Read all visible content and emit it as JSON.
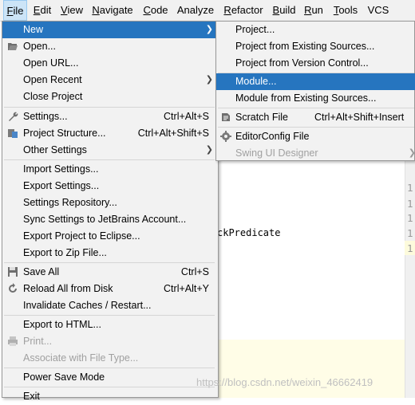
{
  "menubar": {
    "items": [
      {
        "label": "File",
        "mnemonic": "F",
        "rest": "ile"
      },
      {
        "label": "Edit",
        "mnemonic": "E",
        "rest": "dit"
      },
      {
        "label": "View",
        "mnemonic": "V",
        "rest": "iew"
      },
      {
        "label": "Navigate",
        "mnemonic": "N",
        "rest": "avigate"
      },
      {
        "label": "Code",
        "mnemonic": "C",
        "rest": "ode"
      },
      {
        "label": "Analyze",
        "mnemonic": "",
        "rest": "Analyze"
      },
      {
        "label": "Refactor",
        "mnemonic": "R",
        "rest": "efactor"
      },
      {
        "label": "Build",
        "mnemonic": "B",
        "rest": "uild"
      },
      {
        "label": "Run",
        "mnemonic": "R",
        "rest": "un"
      },
      {
        "label": "Tools",
        "mnemonic": "T",
        "rest": "ools"
      },
      {
        "label": "VCS",
        "mnemonic": "",
        "rest": "VCS"
      }
    ]
  },
  "file_menu": {
    "items": [
      {
        "label": "New"
      },
      {
        "label": "Open..."
      },
      {
        "label": "Open URL..."
      },
      {
        "label": "Open Recent"
      },
      {
        "label": "Close Project"
      },
      {
        "label": "Settings...",
        "shortcut": "Ctrl+Alt+S"
      },
      {
        "label": "Project Structure...",
        "shortcut": "Ctrl+Alt+Shift+S"
      },
      {
        "label": "Other Settings"
      },
      {
        "label": "Import Settings..."
      },
      {
        "label": "Export Settings..."
      },
      {
        "label": "Settings Repository..."
      },
      {
        "label": "Sync Settings to JetBrains Account..."
      },
      {
        "label": "Export Project to Eclipse..."
      },
      {
        "label": "Export to Zip File..."
      },
      {
        "label": "Save All",
        "shortcut": "Ctrl+S"
      },
      {
        "label": "Reload All from Disk",
        "shortcut": "Ctrl+Alt+Y"
      },
      {
        "label": "Invalidate Caches / Restart..."
      },
      {
        "label": "Export to HTML..."
      },
      {
        "label": "Print..."
      },
      {
        "label": "Associate with File Type..."
      },
      {
        "label": "Power Save Mode"
      },
      {
        "label": "Exit"
      }
    ]
  },
  "new_submenu": {
    "items": [
      {
        "label": "Project..."
      },
      {
        "label": "Project from Existing Sources..."
      },
      {
        "label": "Project from Version Control..."
      },
      {
        "label": "Module..."
      },
      {
        "label": "Module from Existing Sources..."
      },
      {
        "label": "Scratch File",
        "shortcut": "Ctrl+Alt+Shift+Insert"
      },
      {
        "label": "EditorConfig File"
      },
      {
        "label": "Swing UI Designer"
      }
    ]
  },
  "editor": {
    "code_fragment": "ckPredicate",
    "gutter_numbers": [
      "1",
      "1",
      "1",
      "1",
      "1"
    ]
  },
  "watermark": "https://blog.csdn.net/weixin_46662419",
  "colors": {
    "highlight": "#2675bf",
    "menu_bg": "#f2f2f2",
    "menubar_active": "#cce4f7"
  }
}
